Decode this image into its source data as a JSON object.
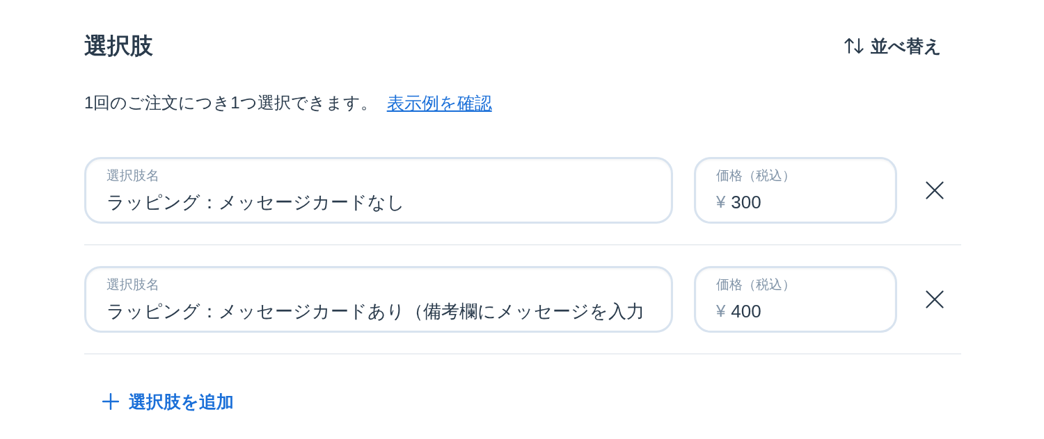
{
  "header": {
    "title": "選択肢",
    "sort_button": "並べ替え"
  },
  "description": {
    "text": "1回のご注文につき1つ選択できます。",
    "link": "表示例を確認"
  },
  "options": [
    {
      "name_label": "選択肢名",
      "name": "ラッピング：メッセージカードなし",
      "price_label": "価格（税込）",
      "currency": "¥",
      "price": "300"
    },
    {
      "name_label": "選択肢名",
      "name": "ラッピング：メッセージカードあり（備考欄にメッセージを入力",
      "price_label": "価格（税込）",
      "currency": "¥",
      "price": "400"
    }
  ],
  "add_button": "選択肢を追加"
}
